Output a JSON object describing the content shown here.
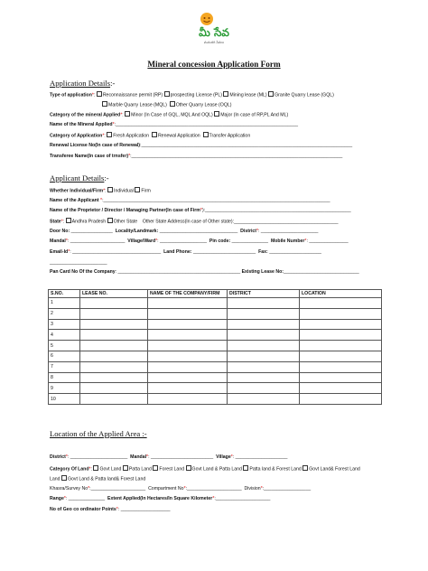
{
  "logo": {
    "text": "మీ సేవ",
    "tagline": "మనందరి సేవలు"
  },
  "title": "Mineral concession Application Form",
  "application_details": {
    "heading": "Application Details",
    "suffix": ":-",
    "type_label": "Type of application",
    "type_opts": [
      "Reconnaissance permit (RP)",
      "prospecting License (PL)",
      "Mining lease (ML)",
      "Granite Quarry Lease (GQL)",
      "Marble Quarry Lease (MQL)",
      "Other Quarry Lease (OQL)"
    ],
    "category_label": "Category of the mineral Applied",
    "category_opts": [
      "Minor (In Case of GQL, MQL And OQL)",
      "Major (In case of RP,PL And ML)"
    ],
    "mineral_name_label": "Name of the Mineral Applied",
    "app_category_label": "Category of Application",
    "app_category_opts": [
      "Fresh Application",
      "Renewal Application",
      "Transfer Application"
    ],
    "renewal_label": "Renewal License No(In case of Renewal)",
    "transferee_label": "Transferee Name(In case of trnsfer)"
  },
  "applicant_details": {
    "heading": "Applicant Details",
    "suffix": ":-",
    "whether_label": "Whether Individual/Firm",
    "whether_opts": [
      "Individual",
      "Firm"
    ],
    "name_label": "Name of the Applicant",
    "proprietor_label": "Name of the Proprietor / Director / Managing Partner(In case of Firm",
    "state_label": "State",
    "state_opts": [
      "Andhra Pradesh",
      "Other State"
    ],
    "other_state_label": "Other State Address(In case of Other state)",
    "door_label": "Door No:",
    "locality_label": "Locality/Landmark:",
    "district_label": "District",
    "mandal_label": "Mandal",
    "village_label": "Village/Ward",
    "pincode_label": "Pin code:",
    "mobile_label": "Mobile Number",
    "email_label": "Email-Id",
    "landphone_label": "Land Phone:",
    "fax_label": "Fax:",
    "pan_label": "Pan Card No  Of the Company",
    "existing_lease_label": "Existing Lease No:"
  },
  "table": {
    "headers": [
      "S.NO.",
      "LEASE NO.",
      "NAME OF THE COMPANY/FIRM",
      "DISTRICT",
      "LOCATION"
    ],
    "rows": [
      "1",
      "2",
      "3",
      "4",
      "5",
      "6",
      "7",
      "8",
      "9",
      "10"
    ]
  },
  "location": {
    "heading": "Location of the Applied Area :-",
    "district_label": "District",
    "mandal_label": "Mandal",
    "village_label": "Village",
    "category_label": "Category Of Land",
    "category_opts": [
      "Govt Land",
      "Patta Land",
      "Forest Land",
      "Govt Land & Patta Land",
      "Patta land &  Forest Land",
      "Govt Land& Forest Land",
      "Govt Land & Patta land& Forest Land"
    ],
    "khasra_label": "Khasra/Survey No",
    "compartment_label": "Compartment No",
    "division_label": "Division",
    "range_label": "Range",
    "extent_label": "Extent Applied(In  Hectares/In Square Kilometer",
    "geo_label": "No of Geo co ordinator Points"
  },
  "colors": {
    "required_star": "#e00000",
    "logo_face": "#f5a623",
    "logo_text": "#2e9e3a"
  },
  "icons": [
    "checkbox-icon",
    "smiley-logo-icon"
  ]
}
